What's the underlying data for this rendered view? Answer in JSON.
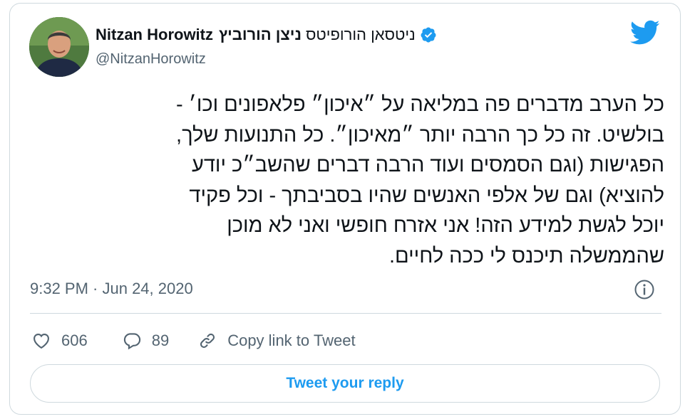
{
  "author": {
    "display_name": "Nitzan Horowitz",
    "display_name_he": "ניצן הורוביץ",
    "display_name_he_alt": "ניטסאן הורופיטס",
    "handle": "@NitzanHorowitz",
    "verified": true
  },
  "tweet": {
    "lines": [
      "כל הערב מדברים פה במליאה על ״איכון״ פלאפונים וכו׳ -",
      "בולשיט. זה כל כך הרבה יותר ״מאיכון״. כל התנועות שלך,",
      "הפגישות (וגם הסמסים ועוד הרבה דברים שהשב״כ יודע",
      "להוציא) וגם של אלפי האנשים שהיו בסביבתך - וכל פקיד",
      "יוכל לגשת למידע הזה! אני אזרח חופשי ואני לא מוכן",
      "שהממשלה תיכנס לי ככה לחיים."
    ],
    "timestamp": "9:32 PM · Jun 24, 2020"
  },
  "actions": {
    "like_count": "606",
    "reply_count": "89",
    "copy_link_label": "Copy link to Tweet"
  },
  "reply_button_label": "Tweet your reply",
  "icons": {
    "brand": "twitter-bird-icon",
    "verified": "verified-badge-icon",
    "info": "info-icon",
    "like": "heart-icon",
    "reply": "speech-bubble-icon",
    "link": "link-icon"
  },
  "colors": {
    "accent": "#1d9bf0",
    "secondary_text": "#536471",
    "border": "#cfd9de"
  }
}
